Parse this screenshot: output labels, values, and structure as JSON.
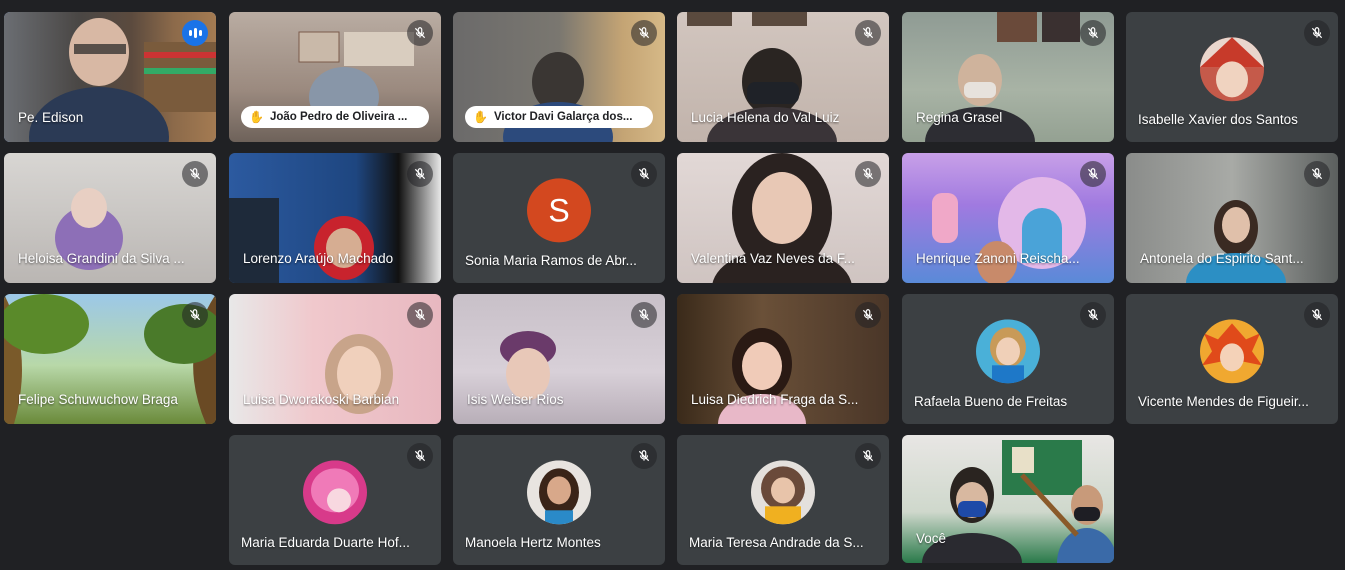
{
  "participants": [
    {
      "name": "Pe. Edison",
      "speaking": true
    },
    {
      "name": "João Pedro de Oliveira ...",
      "hand_raised": true
    },
    {
      "name": "Victor Davi Galarça dos...",
      "hand_raised": true
    },
    {
      "name": "Lucia Helena do Val Luiz"
    },
    {
      "name": "Regina Grasel"
    },
    {
      "name": "Isabelle Xavier dos Santos"
    },
    {
      "name": "Heloisa Grandini da Silva ..."
    },
    {
      "name": "Lorenzo Araújo Machado"
    },
    {
      "name": "Sonia Maria Ramos de Abr...",
      "initial": "S"
    },
    {
      "name": "Valentina Vaz Neves da F..."
    },
    {
      "name": "Henrique Zanoni Reischa..."
    },
    {
      "name": "Antonela do Espirito Sant..."
    },
    {
      "name": "Felipe Schuwuchow Braga"
    },
    {
      "name": "Luisa Dworakoski Barbian"
    },
    {
      "name": "Isis Weiser Rios"
    },
    {
      "name": "Luisa Diedrich Fraga da S..."
    },
    {
      "name": "Rafaela Bueno de Freitas"
    },
    {
      "name": "Vicente Mendes de Figueir..."
    },
    {
      "name": "Maria Eduarda Duarte Hof..."
    },
    {
      "name": "Manoela Hertz Montes"
    },
    {
      "name": "Maria Teresa Andrade da S..."
    },
    {
      "name": "Você"
    }
  ],
  "colors": {
    "background": "#202124",
    "tile": "#3c4043",
    "speaking_border": "#8ab4f8",
    "accent": "#1a73e8"
  },
  "icons": {
    "muted": "mic-off-icon",
    "speaking": "audio-level-icon",
    "hand": "raised-hand-icon"
  }
}
